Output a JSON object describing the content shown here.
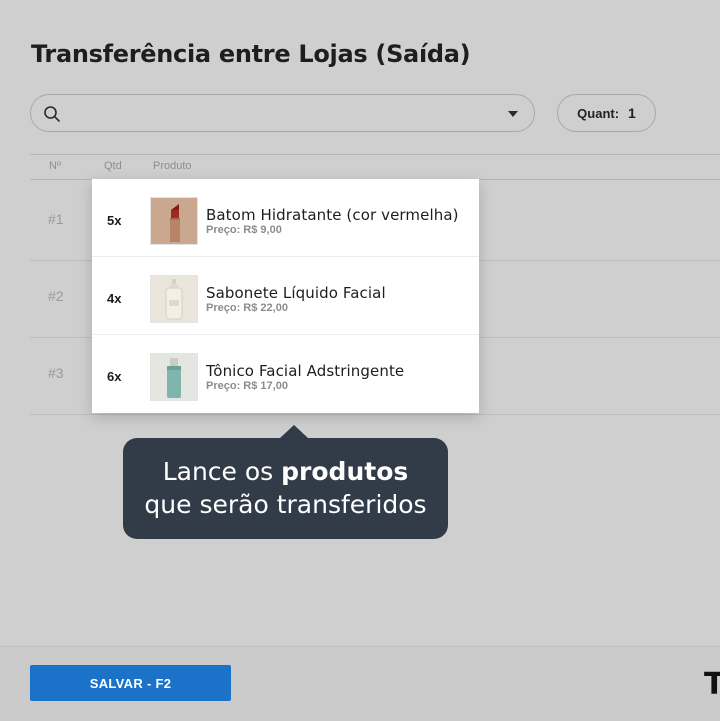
{
  "page": {
    "title": "Transferência entre Lojas (Saída)"
  },
  "search": {
    "value": "",
    "placeholder": ""
  },
  "quantity": {
    "label": "Quant:",
    "value": "1"
  },
  "table": {
    "headers": {
      "number": "Nº",
      "qty": "Qtd",
      "product": "Produto"
    },
    "rows": [
      {
        "index": "#1"
      },
      {
        "index": "#2"
      },
      {
        "index": "#3"
      }
    ]
  },
  "suggestions": [
    {
      "qty": "5x",
      "name": "Batom Hidratante (cor vermelha)",
      "price": "Preço: R$ 9,00",
      "icon": "lipstick-thumbnail"
    },
    {
      "qty": "4x",
      "name": "Sabonete Líquido Facial",
      "price": "Preço: R$ 22,00",
      "icon": "soap-bottle-thumbnail"
    },
    {
      "qty": "6x",
      "name": "Tônico Facial Adstringente",
      "price": "Preço: R$ 17,00",
      "icon": "toner-bottle-thumbnail"
    }
  ],
  "tooltip": {
    "prefix": "Lance os ",
    "bold": "produtos",
    "line2": "que serão transferidos"
  },
  "footer": {
    "save_label": "SALVAR - F2",
    "brand": "T"
  },
  "colors": {
    "primary": "#1a73c9",
    "tooltip_bg": "#323b48",
    "background": "#cfcfcf"
  }
}
